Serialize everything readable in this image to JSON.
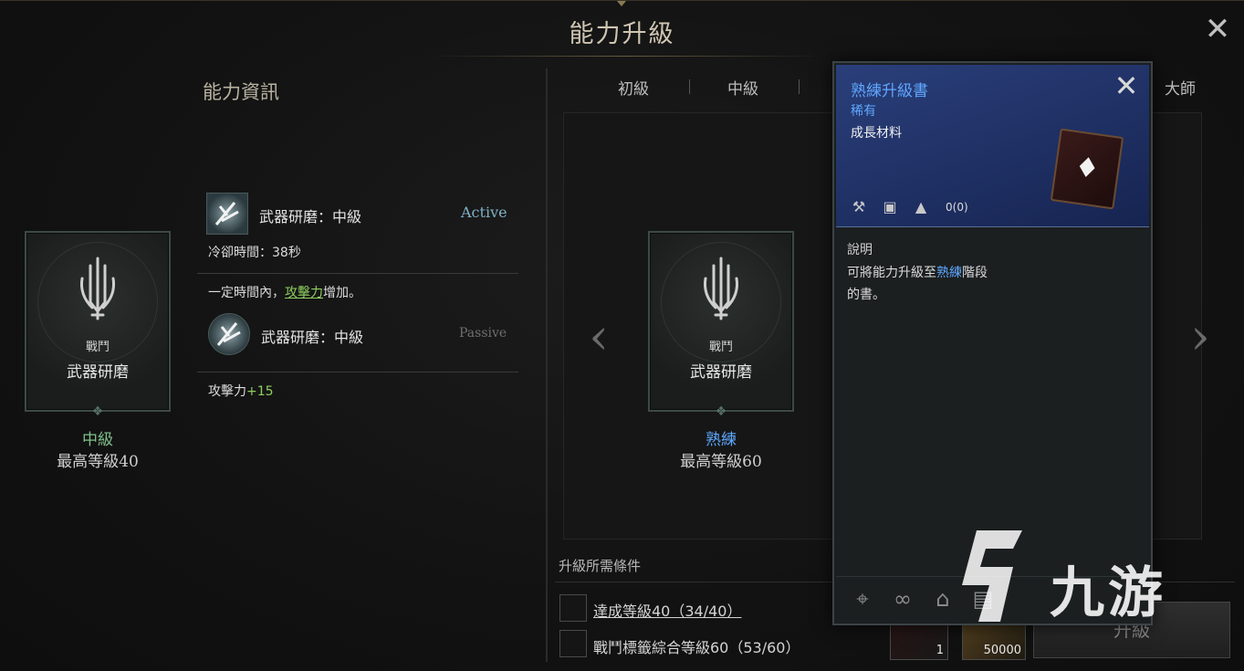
{
  "window": {
    "title": "能力升級",
    "close_icon": "close-icon"
  },
  "left": {
    "heading": "能力資訊",
    "card": {
      "category": "戰鬥",
      "name": "武器研磨",
      "tier": "中級",
      "tier_color": "#7fc08a",
      "max_level": "最高等級40"
    },
    "active_skill": {
      "title": "武器研磨：中級",
      "tag": "Active",
      "cooldown": "冷卻時間：38秒"
    },
    "effect_line": {
      "prefix": "一定時間內，",
      "keyword": "攻擊力",
      "suffix": "增加。"
    },
    "passive_skill": {
      "title": "武器研磨：中級",
      "tag": "Passive"
    },
    "stat": {
      "name": "攻擊力",
      "bonus": "+15"
    }
  },
  "tabs": [
    {
      "label": "初級"
    },
    {
      "label": "中級"
    },
    {
      "label": "大師"
    }
  ],
  "stage": {
    "card": {
      "category": "戰鬥",
      "name": "武器研磨",
      "tier": "熟練",
      "tier_color": "#5fa8ff",
      "max_level": "最高等級60"
    }
  },
  "requirements": {
    "title": "升級所需條件",
    "items": [
      {
        "text": "達成等級40（34/40）"
      },
      {
        "text": "戰鬥標籤綜合等級60（53/60）"
      }
    ]
  },
  "costs": [
    {
      "icon": "book-icon",
      "value": "1"
    },
    {
      "icon": "gold-coin-icon",
      "value": "50000"
    }
  ],
  "upgrade_button": {
    "label": "升級"
  },
  "tooltip": {
    "name": "熟練升級書",
    "rarity": "稀有",
    "type": "成長材料",
    "count": "0(0)",
    "desc_label": "說明",
    "desc_pre": "可將能力升級至",
    "desc_keyword": "熟練",
    "desc_post": "階段",
    "desc_line2": "的書。"
  },
  "watermark": {
    "text": "九游"
  }
}
